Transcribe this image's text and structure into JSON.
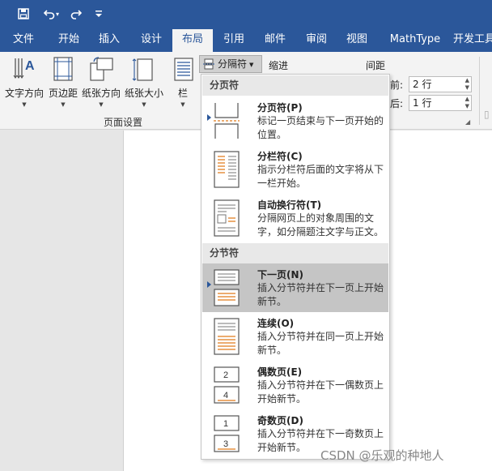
{
  "qat": {
    "save_icon": "save-icon",
    "undo_icon": "undo-icon",
    "redo_icon": "redo-icon",
    "customize_icon": "customize-qat-icon"
  },
  "tabs": [
    {
      "label": "文件"
    },
    {
      "label": "开始"
    },
    {
      "label": "插入"
    },
    {
      "label": "设计"
    },
    {
      "label": "布局"
    },
    {
      "label": "引用"
    },
    {
      "label": "邮件"
    },
    {
      "label": "审阅"
    },
    {
      "label": "视图"
    },
    {
      "label": "MathType"
    },
    {
      "label": "开发工具"
    }
  ],
  "ribbon": {
    "text_direction": "文字方向",
    "margins": "页边距",
    "orientation": "纸张方向",
    "size": "纸张大小",
    "columns": "栏",
    "breaks": "分隔符",
    "group_page_setup": "页面设置",
    "indent": "缩进",
    "spacing": "间距",
    "before_label": "段前:",
    "before_value": "2 行",
    "after_label": "段后:",
    "after_value": "1 行"
  },
  "menu": {
    "section_page_breaks": "分页符",
    "section_section_breaks": "分节符",
    "items": [
      {
        "title": "分页符(P)",
        "desc": "标记一页结束与下一页开始的位置。"
      },
      {
        "title": "分栏符(C)",
        "desc": "指示分栏符后面的文字将从下一栏开始。"
      },
      {
        "title": "自动换行符(T)",
        "desc": "分隔网页上的对象周围的文字，如分隔题注文字与正文。"
      },
      {
        "title": "下一页(N)",
        "desc": "插入分节符并在下一页上开始新节。"
      },
      {
        "title": "连续(O)",
        "desc": "插入分节符并在同一页上开始新节。"
      },
      {
        "title": "偶数页(E)",
        "desc": "插入分节符并在下一偶数页上开始新节。"
      },
      {
        "title": "奇数页(D)",
        "desc": "插入分节符并在下一奇数页上开始新节。"
      }
    ]
  },
  "colors": {
    "brand": "#2b579a",
    "ribbon_bg": "#f3f3f3",
    "hover": "#c5c5c5",
    "icon_accent": "#e07b1a"
  },
  "watermark": "CSDN @乐观的种地人"
}
